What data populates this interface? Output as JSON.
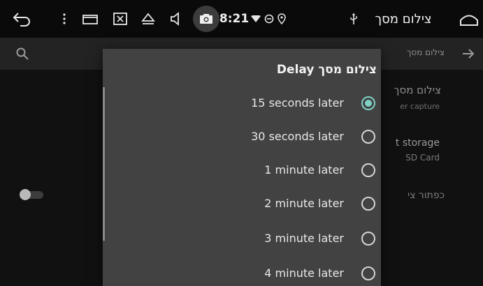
{
  "status_bar": {
    "time": "8:21",
    "app_title": "צילום מסך",
    "icons": [
      "back-icon",
      "more-vert-icon",
      "window-icon",
      "image-icon",
      "eject-icon",
      "volume-icon",
      "camera-icon",
      "wifi-icon",
      "do-not-disturb-icon",
      "location-icon",
      "usb-icon",
      "home-icon"
    ]
  },
  "app_bar": {
    "title": "צילום מסך",
    "icons": [
      "search-icon",
      "arrow-forward-icon"
    ]
  },
  "settings": {
    "item1_title": "צילום מסך",
    "item1_subtitle": "er capture",
    "item2_title": "t storage",
    "item2_subtitle": "SD Card",
    "item3_title": "כפתור צי"
  },
  "dialog": {
    "title": "צילום מסך Delay",
    "options": [
      {
        "label": "15 seconds later",
        "checked": true
      },
      {
        "label": "30 seconds later",
        "checked": false
      },
      {
        "label": "1 minute later",
        "checked": false
      },
      {
        "label": "2 minute later",
        "checked": false
      },
      {
        "label": "3 minute later",
        "checked": false
      },
      {
        "label": "4 minute later",
        "checked": false
      }
    ]
  },
  "colors": {
    "accent": "#7fd1c5",
    "dialog_bg": "#424242",
    "status_bar_bg": "#0a0a0a"
  }
}
